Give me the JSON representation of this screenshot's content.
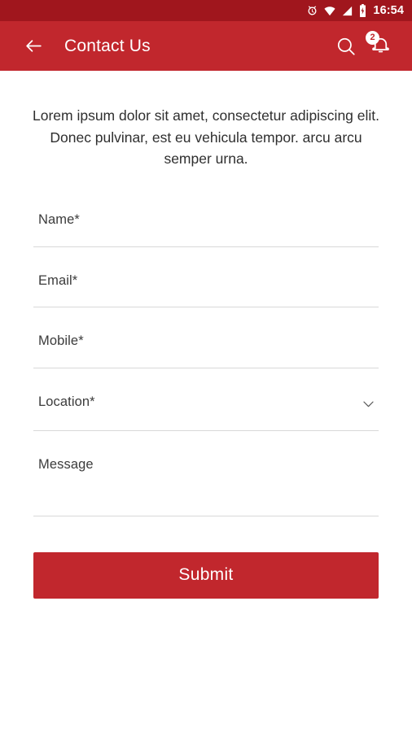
{
  "status_bar": {
    "time": "16:54",
    "icons": [
      "alarm-icon",
      "wifi-icon",
      "signal-icon",
      "battery-charging-icon"
    ],
    "background_color": "#A0161D"
  },
  "app_bar": {
    "title": "Contact Us",
    "back_icon": "arrow-left-icon",
    "search_icon": "search-icon",
    "notification_icon": "bell-icon",
    "notification_count": "2",
    "background_color": "#C1272D",
    "text_color": "#FFFFFF"
  },
  "content": {
    "intro_text": "Lorem ipsum dolor sit amet, consectetur adipiscing elit. Donec pulvinar, est eu vehicula tempor. arcu arcu semper urna."
  },
  "form": {
    "fields": [
      {
        "label": "Name*",
        "type": "text",
        "value": ""
      },
      {
        "label": "Email*",
        "type": "email",
        "value": ""
      },
      {
        "label": "Mobile*",
        "type": "tel",
        "value": ""
      },
      {
        "label": "Location*",
        "type": "select",
        "value": "",
        "icon": "chevron-down-icon"
      },
      {
        "label": "Message",
        "type": "textarea",
        "value": ""
      }
    ],
    "submit_label": "Submit",
    "accent_color": "#C1272D",
    "underline_color": "#D8D8D8",
    "label_color": "#3B3B3B"
  }
}
